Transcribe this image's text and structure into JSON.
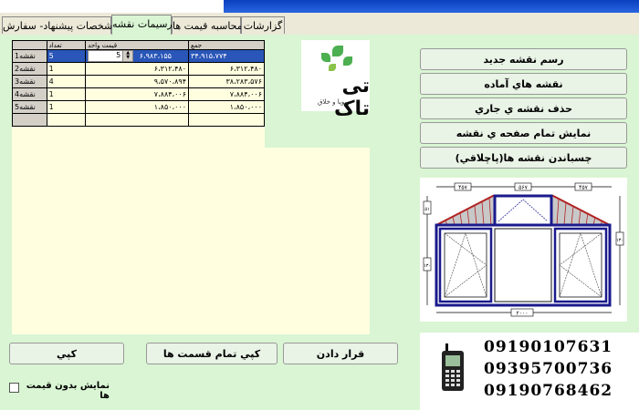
{
  "tabs": [
    {
      "label": "گزارشات",
      "active": false
    },
    {
      "label": "محاسبه قیمت ها",
      "active": false
    },
    {
      "label": "ترسیمات نقشه",
      "active": true
    },
    {
      "label": "مشخصات پیشنهاد- سفارش",
      "active": false
    }
  ],
  "grid": {
    "headers": {
      "qty": "تعداد",
      "unit": "قيمت واحد",
      "sum": "جمع"
    },
    "spinner_value": "5",
    "rows": [
      {
        "name": "نقشه1",
        "qty": "5",
        "unit": "۶،۹۸۳،۱۵۵",
        "sum": "۳۴،۹۱۵،۷۷۴",
        "selected": true
      },
      {
        "name": "نقشه2",
        "qty": "1",
        "unit": "۶،۳۱۲،۴۸۰",
        "sum": "۶،۳۱۲،۴۸۰",
        "selected": false
      },
      {
        "name": "نقشه3",
        "qty": "4",
        "unit": "۹،۵۷۰،۸۹۴",
        "sum": "۳۸،۲۸۳،۵۷۶",
        "selected": false
      },
      {
        "name": "نقشه4",
        "qty": "1",
        "unit": "۷،۸۸۴،۰۰۶",
        "sum": "۷،۸۸۴،۰۰۶",
        "selected": false
      },
      {
        "name": "نقشه5",
        "qty": "1",
        "unit": "۱،۸۵۰،۰۰۰",
        "sum": "۱،۸۵۰،۰۰۰",
        "selected": false
      }
    ]
  },
  "logo": {
    "brand": "تی تاک",
    "slogan": "پویا و خلاق"
  },
  "side_buttons": {
    "new_drawing": "رسم نقشه جديد",
    "ready_drawings": "نقشه هاي آماده",
    "delete_current": "حذف نقشه ي جاري",
    "fullscreen": "نمايش تمام صفحه ي نقشه",
    "stick_drawings": "چسباندن نقشه ها(پاچلاقي)"
  },
  "drawing": {
    "dims": {
      "top_left": "۴۵۷",
      "top_mid": "۵۶۷",
      "top_right": "۴۵۷",
      "left_top": "۵۱",
      "left_main": "۱۳۰",
      "right_main": "۱۳۰",
      "bottom": "۲۰۰۰"
    }
  },
  "bottom_buttons": {
    "place": "قرار دادن",
    "copy_all": "كپي تمام قسمت ها",
    "copy": "كپي"
  },
  "checkbox": {
    "label": "نمايش بدون قيمت ها",
    "checked": false
  },
  "phones": [
    "09190107631",
    "09395700736",
    "09190768462"
  ]
}
